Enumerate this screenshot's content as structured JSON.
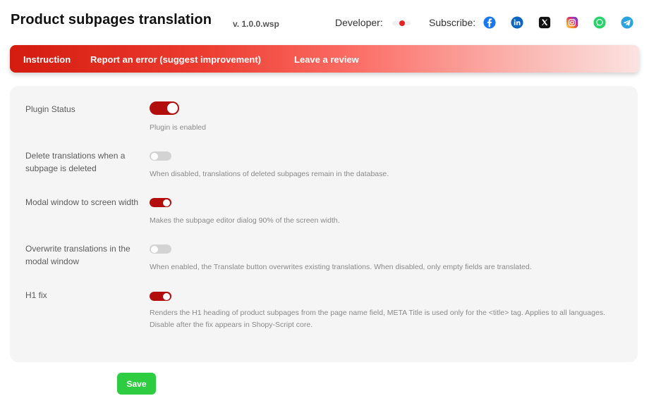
{
  "header": {
    "title": "Product subpages translation",
    "version": "v. 1.0.0.wsp",
    "developer_label": "Developer:",
    "subscribe_label": "Subscribe:",
    "social_icons": [
      "facebook-icon",
      "linkedin-icon",
      "x-icon",
      "instagram-icon",
      "whatsapp-icon",
      "telegram-icon"
    ]
  },
  "nav": {
    "links": [
      "Instruction",
      "Report an error (suggest improvement)",
      "Leave a review"
    ],
    "gradient_colors": [
      "#d41c0f",
      "#fbe3e1"
    ]
  },
  "settings": [
    {
      "label": "Plugin Status",
      "enabled": true,
      "description": "Plugin is enabled"
    },
    {
      "label": "Delete translations when a subpage is deleted",
      "enabled": false,
      "description": "When disabled, translations of deleted subpages remain in the database."
    },
    {
      "label": "Modal window to screen width",
      "enabled": true,
      "description": "Makes the subpage editor dialog 90% of the screen width."
    },
    {
      "label": "Overwrite translations in the modal window",
      "enabled": false,
      "description": "When enabled, the Translate button overwrites existing translations. When disabled, only empty fields are translated."
    },
    {
      "label": "H1 fix",
      "enabled": true,
      "description": "Renders the H1 heading of product subpages from the page name field, META Title is used only for the <title> tag. Applies to all languages. Disable after the fix appears in Shopy-Script core."
    }
  ],
  "actions": {
    "save_label": "Save"
  },
  "colors": {
    "toggle_on": "#b30e0e",
    "toggle_off": "#d3d3d3",
    "save_button": "#2ecc40",
    "panel_bg": "#f5f5f5"
  }
}
